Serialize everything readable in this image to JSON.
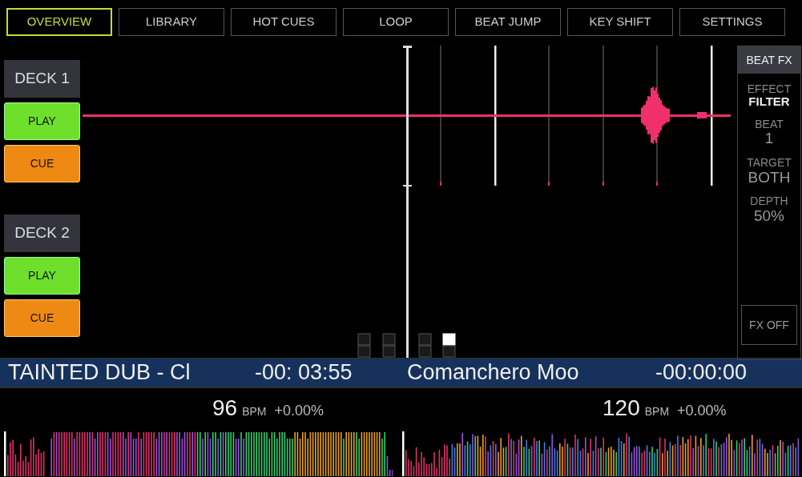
{
  "tabs": [
    {
      "label": "OVERVIEW",
      "selected": true
    },
    {
      "label": "LIBRARY",
      "selected": false
    },
    {
      "label": "HOT CUES",
      "selected": false
    },
    {
      "label": "LOOP",
      "selected": false
    },
    {
      "label": "BEAT JUMP",
      "selected": false
    },
    {
      "label": "KEY SHIFT",
      "selected": false
    },
    {
      "label": "SETTINGS",
      "selected": false
    }
  ],
  "decks": [
    {
      "label": "DECK 1",
      "play": "PLAY",
      "cue": "CUE"
    },
    {
      "label": "DECK 2",
      "play": "PLAY",
      "cue": "CUE"
    }
  ],
  "beat_fx": {
    "title": "BEAT FX",
    "params": [
      {
        "label": "EFFECT",
        "value": "FILTER"
      },
      {
        "label": "BEAT",
        "value": "1"
      },
      {
        "label": "TARGET",
        "value": "BOTH"
      },
      {
        "label": "DEPTH",
        "value": "50%"
      }
    ],
    "off_button": "FX OFF"
  },
  "beat_indicators": [
    {
      "on": false
    },
    {
      "on": false
    },
    {
      "on": false
    },
    {
      "on": true
    }
  ],
  "tracks": [
    {
      "title": "TAINTED DUB - Cl",
      "time": "-00: 03:55"
    },
    {
      "title": "Comanchero Moo",
      "time": "-00:00:00"
    }
  ],
  "bpm": [
    {
      "value": "96",
      "unit": "BPM",
      "pitch": "+0.00%"
    },
    {
      "value": "120",
      "unit": "BPM",
      "pitch": "+0.00%"
    }
  ]
}
